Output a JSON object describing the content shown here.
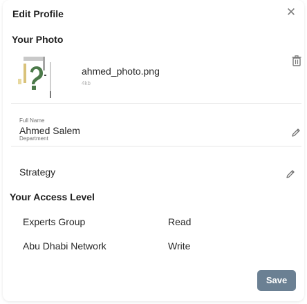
{
  "dialog": {
    "title": "Edit Profile",
    "close_icon": "close-icon"
  },
  "photo": {
    "section_title": "Your Photo",
    "filename": "ahmed_photo.png",
    "filesize": "4kb",
    "delete_icon": "trash-icon"
  },
  "fields": {
    "full_name": {
      "label": "Full Name",
      "value": "Ahmed Salem",
      "icon": "pencil-icon"
    },
    "department": {
      "label": "Department",
      "value": "Strategy",
      "icon": "pencil-icon"
    }
  },
  "access": {
    "section_title": "Your Access Level",
    "rows": [
      {
        "name": "Experts Group",
        "level": "Read"
      },
      {
        "name": "Abu Dhabi Network",
        "level": "Write"
      }
    ]
  },
  "actions": {
    "save_label": "Save"
  },
  "colors": {
    "save_button": "#6b8093",
    "divider": "#e6e6e6",
    "muted": "#7d7d7d"
  }
}
